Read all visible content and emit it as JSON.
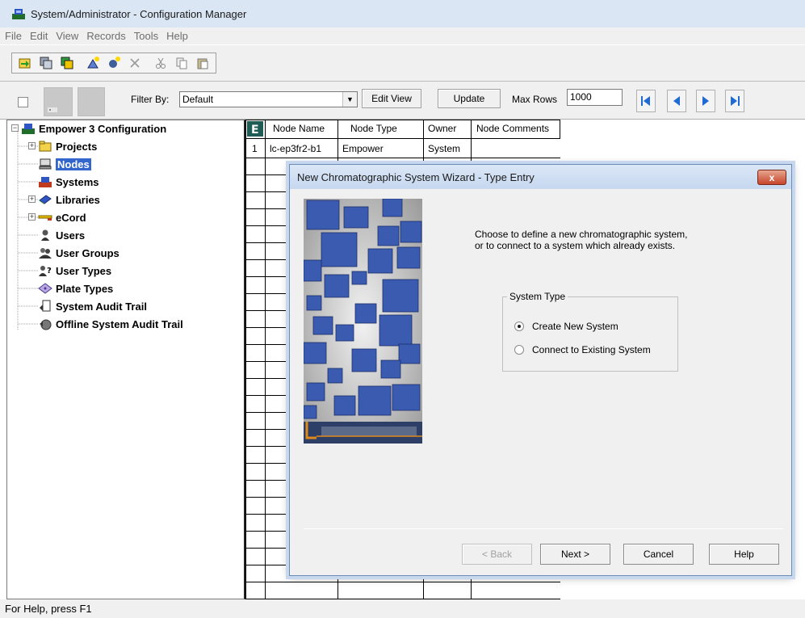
{
  "window": {
    "title": "System/Administrator - Configuration Manager"
  },
  "menu": [
    "File",
    "Edit",
    "View",
    "Records",
    "Tools",
    "Help"
  ],
  "toolbar": {
    "icons": [
      "open-project-icon",
      "copy-node-icon",
      "paste-node-icon",
      "new-item-icon",
      "new-wizard-icon",
      "delete-icon",
      "cut-icon",
      "copy-icon",
      "paste-icon"
    ]
  },
  "filterbar": {
    "filter_label": "Filter By:",
    "filter_value": "Default",
    "edit_view_label": "Edit View",
    "update_label": "Update",
    "max_rows_label": "Max Rows",
    "max_rows_value": "1000"
  },
  "tree": {
    "root": "Empower 3 Configuration",
    "items": [
      "Projects",
      "Nodes",
      "Systems",
      "Libraries",
      "eCord",
      "Users",
      "User Groups",
      "User Types",
      "Plate Types",
      "System Audit Trail",
      "Offline System Audit Trail"
    ],
    "selected": "Nodes"
  },
  "grid": {
    "columns": [
      "Node Name",
      "Node Type",
      "Owner",
      "Node Comments"
    ],
    "rows": [
      {
        "index": "1",
        "node_name": "lc-ep3fr2-b1",
        "node_type": "Empower",
        "owner": "System",
        "comments": ""
      }
    ]
  },
  "dialog": {
    "title": "New Chromatographic System Wizard - Type Entry",
    "close_label": "x",
    "text_line1": "Choose to define a new chromatographic system,",
    "text_line2": "or to connect to a system which already exists.",
    "group_title": "System Type",
    "option_create": "Create New System",
    "option_connect": "Connect to Existing System",
    "selected_option": "Create New System",
    "back_label": "< Back",
    "next_label": "Next >",
    "cancel_label": "Cancel",
    "help_label": "Help"
  },
  "status": {
    "text": "For Help, press F1"
  },
  "colors": {
    "selection": "#3366cc",
    "cube": "#3b5bb0",
    "accent_orange": "#e0891b"
  }
}
